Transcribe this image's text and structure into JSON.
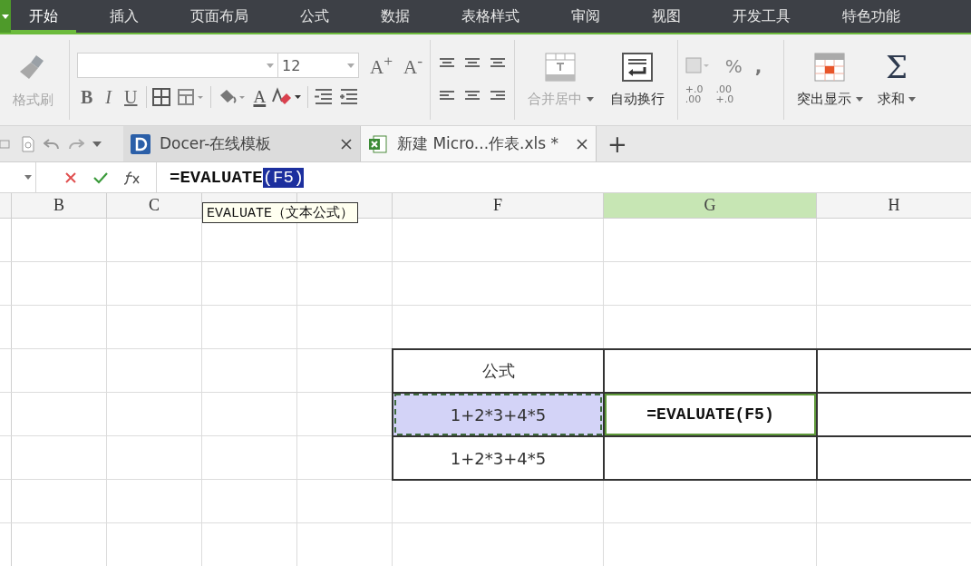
{
  "menu_tabs": [
    {
      "label": "开始",
      "selected": true
    },
    {
      "label": "插入",
      "selected": false
    },
    {
      "label": "页面布局",
      "selected": false
    },
    {
      "label": "公式",
      "selected": false
    },
    {
      "label": "数据",
      "selected": false
    },
    {
      "label": "表格样式",
      "selected": false
    },
    {
      "label": "审阅",
      "selected": false
    },
    {
      "label": "视图",
      "selected": false
    },
    {
      "label": "开发工具",
      "selected": false
    },
    {
      "label": "特色功能",
      "selected": false
    }
  ],
  "ribbon": {
    "format_painter": {
      "label": "格式刷",
      "disabled": true
    },
    "font_size": "12",
    "grow_font": "A$^{+}$",
    "shrink_font": "A$^{-}$",
    "style_buttons": [
      {
        "glyph": "B",
        "kind": "bold"
      },
      {
        "glyph": "I",
        "kind": "italic"
      },
      {
        "glyph": "U",
        "kind": "underline"
      }
    ],
    "font_color": "A",
    "merge": {
      "label": "合并居中",
      "disabled": true
    },
    "wrap": {
      "label": "自动换行",
      "disabled": false
    },
    "percent": "%",
    "comma": ",",
    "decimals": [
      {
        "lines": [
          "+.0",
          ".00"
        ]
      },
      {
        "lines": [
          ".00",
          "+.0"
        ]
      }
    ],
    "highlight": {
      "label": "突出显示"
    },
    "sum": {
      "glyph": "Σ",
      "label": "求和"
    }
  },
  "doc_tabs": [
    {
      "title": "Docer-在线模板",
      "kind": "docer",
      "selected": false
    },
    {
      "title": "新建 Micro...作表.xls *",
      "kind": "sheet",
      "selected": true
    }
  ],
  "new_tab": "+",
  "formula_bar": {
    "parts": [
      {
        "text": "=EVALUATE",
        "highlighted": false
      },
      {
        "text": "(F5)",
        "highlighted": true
      }
    ]
  },
  "tooltip": "EVALUATE（文本公式）",
  "sheet": {
    "columns": [
      {
        "label": "B",
        "selected": false
      },
      {
        "label": "C",
        "selected": false
      },
      {
        "selected": false
      },
      {
        "selected": false
      },
      {
        "label": "F",
        "selected": false
      },
      {
        "label": "G",
        "selected": true
      },
      {
        "label": "H",
        "selected": false
      }
    ],
    "table": [
      [
        {
          "text": "公式",
          "selected": false,
          "copied": false,
          "active": false
        },
        {
          "selected": false,
          "copied": false,
          "active": false
        },
        {
          "selected": false,
          "copied": false,
          "active": false
        }
      ],
      [
        {
          "text": "1+2*3+4*5",
          "selected": true,
          "copied": true,
          "active": false
        },
        {
          "text": "=EVALUATE(F5)",
          "selected": false,
          "copied": false,
          "active": true
        },
        {
          "selected": false,
          "copied": false,
          "active": false
        }
      ],
      [
        {
          "text": "1+2*3+4*5",
          "selected": false,
          "copied": false,
          "active": false
        },
        {
          "selected": false,
          "copied": false,
          "active": false
        },
        {
          "selected": false,
          "copied": false,
          "active": false
        }
      ]
    ]
  }
}
